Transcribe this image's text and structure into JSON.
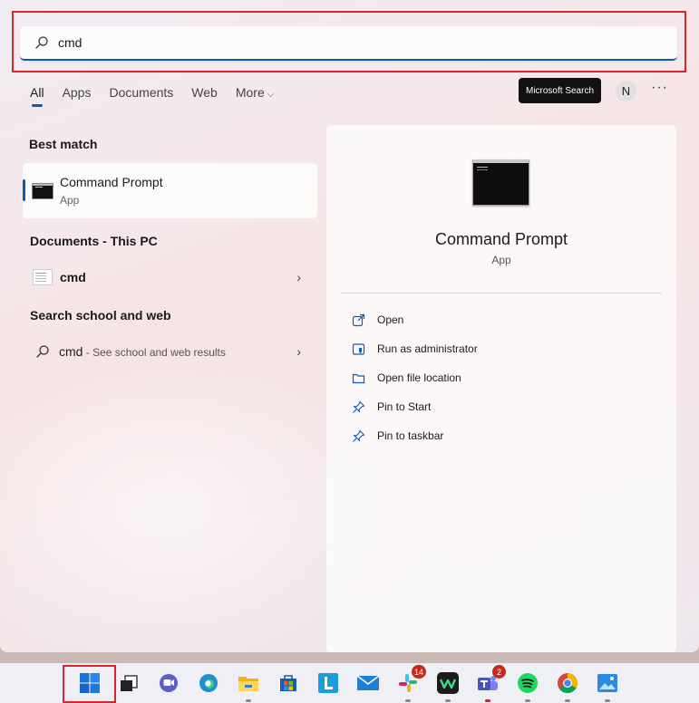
{
  "search": {
    "value": "cmd",
    "placeholder": ""
  },
  "tabs": [
    {
      "label": "All",
      "active": true
    },
    {
      "label": "Apps"
    },
    {
      "label": "Documents"
    },
    {
      "label": "Web"
    },
    {
      "label": "More"
    }
  ],
  "header": {
    "ms_search_label": "Microsoft Search",
    "avatar_initial": "N",
    "more_options": "···"
  },
  "best_match": {
    "section_title": "Best match",
    "name": "Command Prompt",
    "type": "App"
  },
  "documents": {
    "section_title": "Documents - This PC",
    "items": [
      {
        "label": "cmd"
      }
    ]
  },
  "web": {
    "section_title": "Search school and web",
    "query": "cmd",
    "hint": " - See school and web results"
  },
  "preview": {
    "title": "Command Prompt",
    "subtitle": "App",
    "actions": [
      {
        "label": "Open",
        "icon": "open-external-icon"
      },
      {
        "label": "Run as administrator",
        "icon": "shield-icon"
      },
      {
        "label": "Open file location",
        "icon": "folder-icon"
      },
      {
        "label": "Pin to Start",
        "icon": "pin-icon"
      },
      {
        "label": "Pin to taskbar",
        "icon": "pin-icon"
      }
    ]
  },
  "taskbar": {
    "slack_badge": "14",
    "teams_badge": "2"
  },
  "colors": {
    "accent": "#0b5cad",
    "highlight": "#d9262e"
  }
}
